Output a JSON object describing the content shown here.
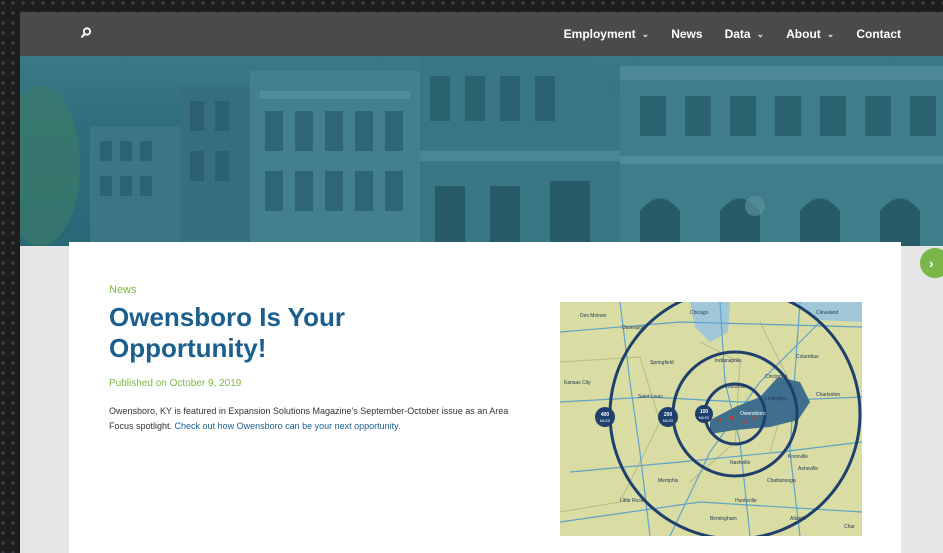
{
  "nav": {
    "items": [
      {
        "label": "Employment",
        "dropdown": true
      },
      {
        "label": "News",
        "dropdown": false
      },
      {
        "label": "Data",
        "dropdown": true
      },
      {
        "label": "About",
        "dropdown": true
      },
      {
        "label": "Contact",
        "dropdown": false
      }
    ],
    "search_icon": "search-icon"
  },
  "article": {
    "category": "News",
    "title": "Owensboro Is Your Opportunity!",
    "published": "Published on October 9, 2019",
    "body_text": "Owensboro, KY is featured in Expansion Solutions Magazine's September-October issue as an Area Focus spotlight.",
    "body_link": "Check out how Owensboro can be your next opportunity."
  },
  "map": {
    "cities": [
      "Des Moines",
      "Davenport",
      "Chicago",
      "Cleveland",
      "Springfield",
      "Indianapolis",
      "Columbus",
      "Kansas City",
      "Saint Louis",
      "Cincinnati",
      "Louisville",
      "Lexington",
      "Charleston",
      "Owensboro",
      "Nashville",
      "Knoxville",
      "Asheville",
      "Memphis",
      "Chattanooga",
      "Little Rock",
      "Huntsville",
      "Birmingham",
      "Atlanta",
      "Char"
    ],
    "rings": [
      "400 MILES",
      "200 MILES",
      "100 MILES"
    ]
  },
  "colors": {
    "nav_bg": "#4a4a4b",
    "title": "#1b5f8e",
    "accent": "#7ab648",
    "hero_tint": "#2f6d79"
  }
}
